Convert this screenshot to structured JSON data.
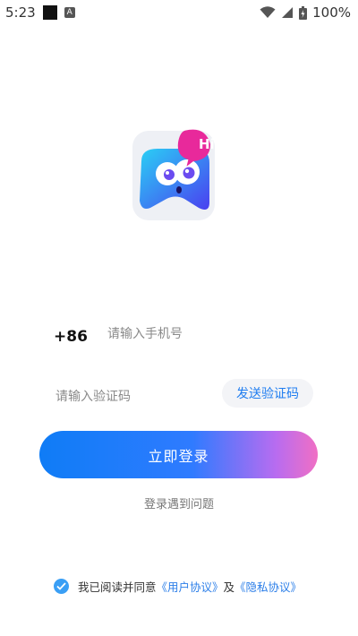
{
  "status_bar": {
    "time": "5:23",
    "battery": "100%"
  },
  "login": {
    "country_code": "+86",
    "phone_placeholder": "请输入手机号",
    "code_placeholder": "请输入验证码",
    "send_code": "发送验证码",
    "login_button": "立即登录",
    "trouble_link": "登录遇到问题"
  },
  "agreement": {
    "prefix": "我已阅读并同意",
    "user_agreement": "《用户协议》",
    "conjunction": "及",
    "privacy_policy": "《隐私协议》"
  },
  "logo": {
    "badge_text": "Hi"
  },
  "colors": {
    "primary": "#1f7df0",
    "gradient_start": "#0f7cf6",
    "gradient_end": "#f06fc4",
    "check": "#3a9ff5"
  }
}
